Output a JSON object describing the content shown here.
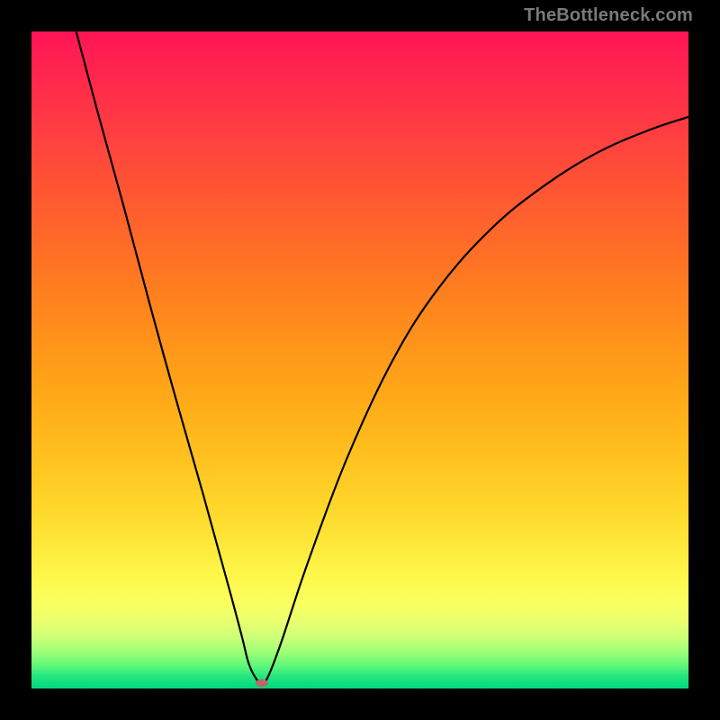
{
  "watermark": "TheBottleneck.com",
  "chart_data": {
    "type": "line",
    "title": "",
    "xlabel": "",
    "ylabel": "",
    "xlim": [
      0,
      100
    ],
    "ylim": [
      0,
      100
    ],
    "series": [
      {
        "name": "curve",
        "x": [
          6.8,
          10,
          14,
          18,
          22,
          26,
          30,
          32,
          33,
          34,
          35,
          36,
          38,
          42,
          48,
          55,
          62,
          70,
          78,
          86,
          94,
          100
        ],
        "values": [
          100,
          88,
          73.5,
          58.5,
          44,
          30,
          15.5,
          8,
          4,
          1.8,
          0.8,
          1.8,
          7,
          19,
          35,
          50,
          61,
          70,
          76.5,
          81.5,
          85,
          87
        ]
      }
    ],
    "marker": {
      "x": 35,
      "y": 0.8,
      "color": "#b86a6a"
    },
    "background_gradient": {
      "type": "vertical",
      "stops": [
        {
          "pos": 0,
          "color": "#ff1456"
        },
        {
          "pos": 50,
          "color": "#ffaa18"
        },
        {
          "pos": 85,
          "color": "#fdf84a"
        },
        {
          "pos": 100,
          "color": "#00d880"
        }
      ]
    }
  }
}
